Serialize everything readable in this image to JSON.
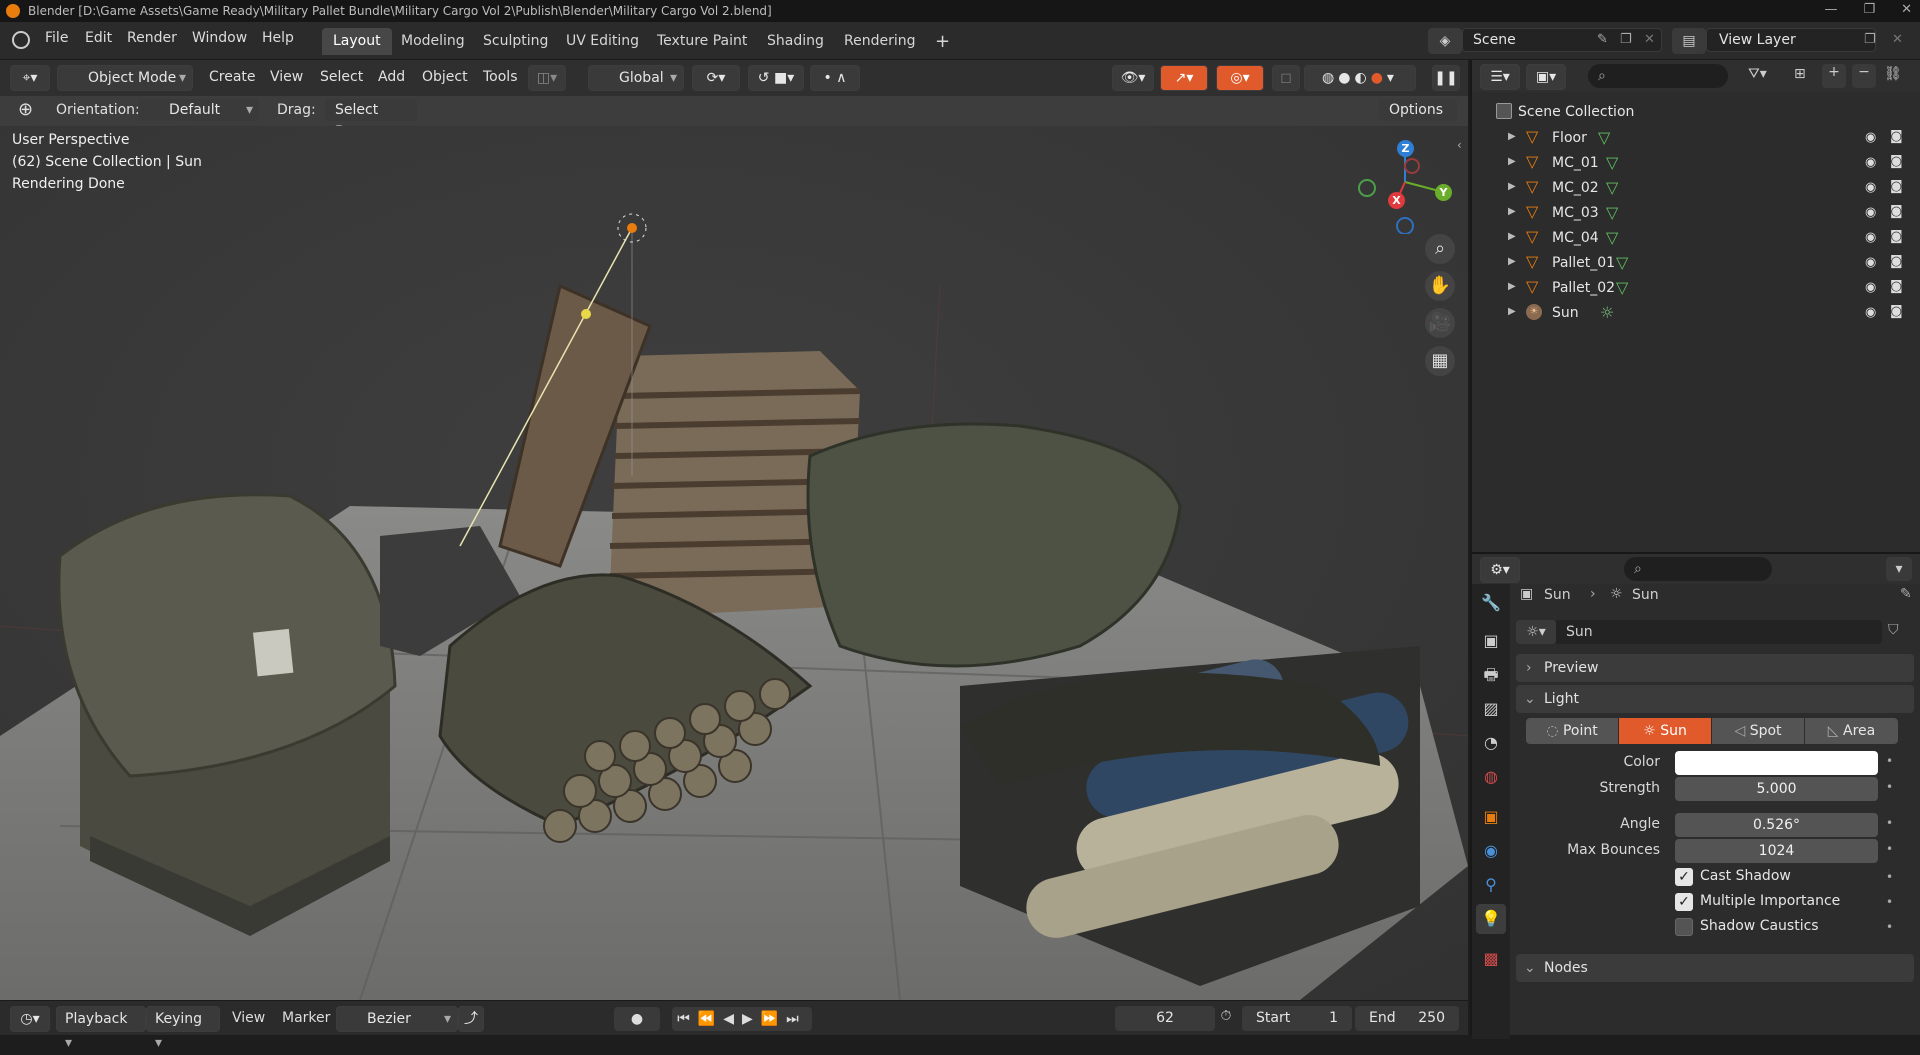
{
  "title_bar": {
    "text": "Blender [D:\\Game Assets\\Game Ready\\Military Pallet Bundle\\Military Cargo Vol 2\\Publish\\Blender\\Military Cargo Vol 2.blend]"
  },
  "menu": {
    "items": [
      "File",
      "Edit",
      "Render",
      "Window",
      "Help"
    ]
  },
  "workspaces": {
    "tabs": [
      "Layout",
      "Modeling",
      "Sculpting",
      "UV Editing",
      "Texture Paint",
      "Shading",
      "Rendering"
    ],
    "active": "Layout",
    "add": "+"
  },
  "scene": {
    "name": "Scene",
    "view_layer": "View Layer"
  },
  "tool_header": {
    "mode": "Object Mode",
    "menus": [
      "Create",
      "View",
      "Select",
      "Add",
      "Object",
      "Tools"
    ],
    "transform": "Global",
    "options": "Options"
  },
  "subheader": {
    "orientation_label": "Orientation:",
    "orientation_value": "Default",
    "drag_label": "Drag:",
    "drag_value": "Select Box"
  },
  "viewport": {
    "line1": "User Perspective",
    "line2": "(62) Scene Collection | Sun",
    "line3": "Rendering Done",
    "gizmo": {
      "x": "X",
      "y": "Y",
      "z": "Z"
    }
  },
  "outliner": {
    "root": "Scene Collection",
    "items": [
      {
        "name": "Floor",
        "type": "mesh"
      },
      {
        "name": "MC_01",
        "type": "mesh"
      },
      {
        "name": "MC_02",
        "type": "mesh"
      },
      {
        "name": "MC_03",
        "type": "mesh"
      },
      {
        "name": "MC_04",
        "type": "mesh"
      },
      {
        "name": "Pallet_01",
        "type": "mesh"
      },
      {
        "name": "Pallet_02",
        "type": "mesh"
      },
      {
        "name": "Sun",
        "type": "light"
      }
    ]
  },
  "properties": {
    "breadcrumb_object": "Sun",
    "breadcrumb_data": "Sun",
    "datablock": "Sun",
    "preview_label": "Preview",
    "light_label": "Light",
    "light_types": [
      "Point",
      "Sun",
      "Spot",
      "Area"
    ],
    "light_type_active": "Sun",
    "color_label": "Color",
    "color_value": "#ffffff",
    "strength_label": "Strength",
    "strength_value": "5.000",
    "angle_label": "Angle",
    "angle_value": "0.526°",
    "max_bounces_label": "Max Bounces",
    "max_bounces_value": "1024",
    "cast_shadow_label": "Cast Shadow",
    "cast_shadow": true,
    "multiple_importance_label": "Multiple Importance",
    "multiple_importance": true,
    "shadow_caustics_label": "Shadow Caustics",
    "shadow_caustics": false,
    "nodes_label": "Nodes"
  },
  "timeline": {
    "playback": "Playback",
    "keying": "Keying",
    "view": "View",
    "marker": "Marker",
    "interpolation": "Bezier",
    "current_frame": "62",
    "start_label": "Start",
    "start_value": "1",
    "end_label": "End",
    "end_value": "250"
  },
  "colors": {
    "accent": "#e87d0d",
    "active_blue": "#4772b3",
    "axis_x": "#e0393e",
    "axis_y": "#6aad2b",
    "axis_z": "#2f7fd6"
  }
}
